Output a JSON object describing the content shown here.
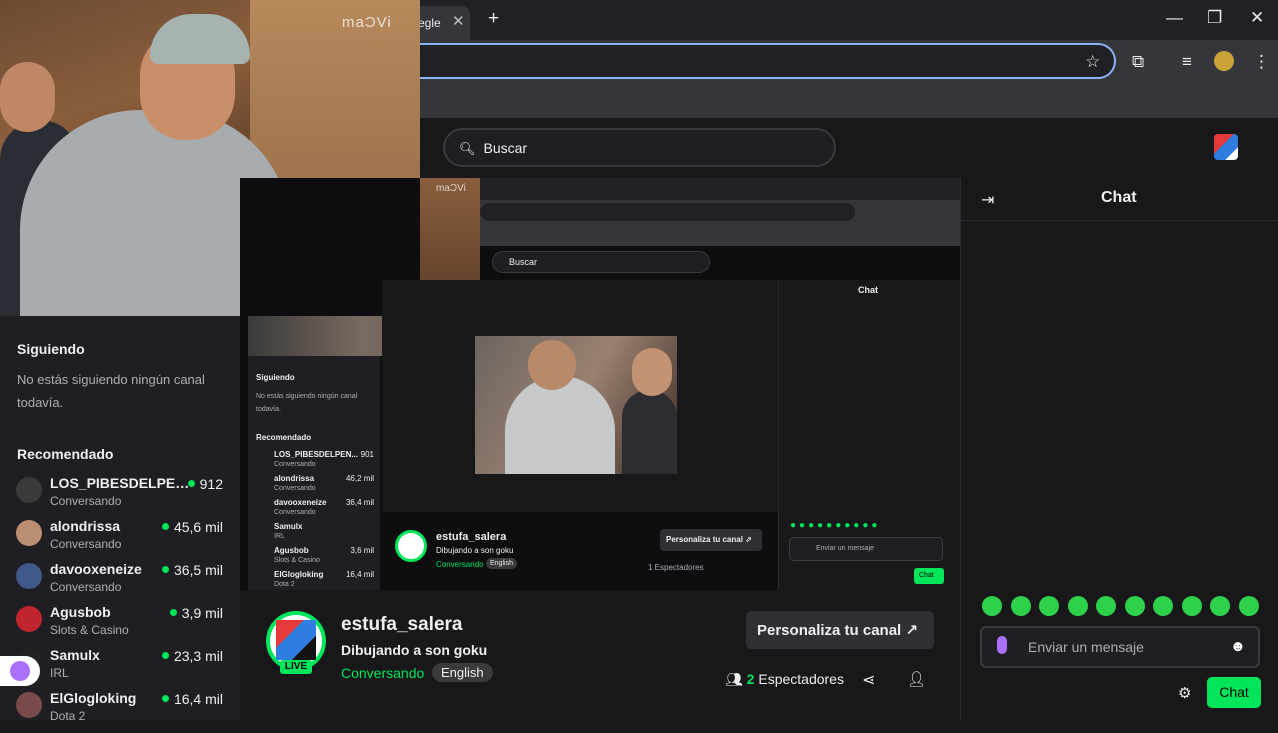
{
  "browser": {
    "tab_title": "egle",
    "close_tab": "✕",
    "new_tab": "+",
    "window_controls": [
      "—",
      "❐",
      "✕"
    ]
  },
  "site": {
    "search_placeholder": "Buscar"
  },
  "webcam": {
    "watermark": "maƆVi"
  },
  "sidebar": {
    "following_heading": "Siguiendo",
    "following_empty": "No estás siguiendo ningún canal todavía.",
    "recommended_heading": "Recomendado",
    "channels": [
      {
        "name": "LOS_PIBESDELPEN...",
        "category": "Conversando",
        "viewers": "912",
        "avatar_color": "#3a3a3a"
      },
      {
        "name": "alondrissa",
        "category": "Conversando",
        "viewers": "45,6 mil",
        "avatar_color": "#b98e72"
      },
      {
        "name": "davooxeneize",
        "category": "Conversando",
        "viewers": "36,5 mil",
        "avatar_color": "#3f5a8a"
      },
      {
        "name": "Agusbob",
        "category": "Slots & Casino",
        "viewers": "3,9 mil",
        "avatar_color": "#c0242c"
      },
      {
        "name": "Samulx",
        "category": "IRL",
        "viewers": "23,3 mil",
        "avatar_color": "#222222"
      },
      {
        "name": "ElGlogloking",
        "category": "Dota 2",
        "viewers": "16,4 mil",
        "avatar_color": "#7a4a4a"
      }
    ]
  },
  "nested": {
    "webcam_watermark": "maƆVi",
    "search_placeholder": "Buscar",
    "chat_title": "Chat",
    "following_heading": "Siguiendo",
    "following_empty": "No estás siguiendo ningún canal todavía.",
    "recommended_heading": "Recomendado",
    "channels": [
      {
        "name": "LOS_PIBESDELPEN...",
        "category": "Conversando",
        "viewers": "901"
      },
      {
        "name": "alondrissa",
        "category": "Conversando",
        "viewers": "46,2 mil"
      },
      {
        "name": "davooxeneize",
        "category": "Conversando",
        "viewers": "36,4 mil"
      },
      {
        "name": "Samulx",
        "category": "IRL",
        "viewers": ""
      },
      {
        "name": "Agusbob",
        "category": "Slots & Casino",
        "viewers": "3,6 mil"
      },
      {
        "name": "ElGlogloking",
        "category": "Dota 2",
        "viewers": "16,4 mil"
      }
    ],
    "stream_name": "estufa_salera",
    "stream_title": "Dibujando a son goku",
    "category": "Conversando",
    "language": "English",
    "customize_label": "Personaliza tu canal ⇗",
    "spectators": "1 Espectadores",
    "chat_placeholder": "Enviar un mensaje",
    "chat_button": "Chat"
  },
  "stream": {
    "channel_name": "estufa_salera",
    "title": "Dibujando a son goku",
    "category": "Conversando",
    "language": "English",
    "live_badge": "LIVE",
    "customize_label": "Personaliza tu canal",
    "customize_icon": "↗",
    "viewer_count": "2",
    "viewer_label": "Espectadores"
  },
  "chat": {
    "title": "Chat",
    "input_placeholder": "Enviar un mensaje",
    "send_button": "Chat",
    "emote_count": 10
  },
  "colors": {
    "accent_green": "#00e55a",
    "background": "#18181b",
    "sidebar": "#1f1f23",
    "mic_purple": "#a970ff"
  }
}
